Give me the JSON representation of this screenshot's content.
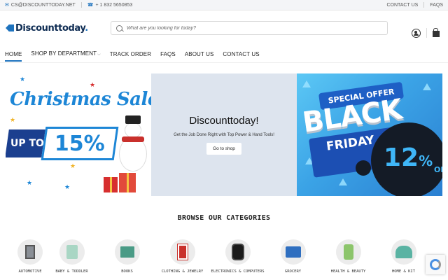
{
  "topbar": {
    "email": "CS@DISCOUNTTODAY.NET",
    "phone": "+ 1 832 5650853",
    "links": [
      "CONTACT US",
      "FAQS"
    ]
  },
  "header": {
    "logo_text": "Discounttoday",
    "logo_dot": ".",
    "search_placeholder": "What are you looking for today?"
  },
  "nav": {
    "items": [
      {
        "label": "HOME",
        "active": true
      },
      {
        "label": "SHOP BY DEPARTMENT",
        "caret": "⌵"
      },
      {
        "label": "TRACK ORDER"
      },
      {
        "label": "FAQS"
      },
      {
        "label": "ABOUT US"
      },
      {
        "label": "CONTACT US"
      }
    ]
  },
  "banners": {
    "christmas": {
      "title": "Christmas Sale",
      "upto": "UP TO",
      "percent": "15%"
    },
    "center": {
      "title": "Discounttoday!",
      "subtitle": "Get the Job Done Right with Top Power & Hand Tools!",
      "button": "Go to shop"
    },
    "blackfriday": {
      "ribbon": "SPECIAL OFFER",
      "black": "BLACK",
      "friday": "FRIDAY",
      "percent": "12",
      "percent_sign": "%",
      "off": "OFF"
    }
  },
  "categories": {
    "title": "BROWSE OUR CATEGORIES",
    "items": [
      {
        "label": "AUTOMOTIVE",
        "icon": "car-jack-icon",
        "color": "#8a8f96"
      },
      {
        "label": "BABY & TODDLER",
        "icon": "baby-product-icon",
        "color": "#a9d6c4"
      },
      {
        "label": "BOOKS",
        "icon": "book-icon",
        "color": "#4a9b86"
      },
      {
        "label": "CLOTHING & JEWELRY",
        "icon": "clothing-icon",
        "color": "#c9302c"
      },
      {
        "label": "ELECTRONICS & COMPUTERS",
        "icon": "smartwatch-icon",
        "color": "#1a1a1a"
      },
      {
        "label": "GROCERY",
        "icon": "grocery-icon",
        "color": "#2f6fc0"
      },
      {
        "label": "HEALTH & BEAUTY",
        "icon": "health-product-icon",
        "color": "#8cc56b"
      },
      {
        "label": "HOME & KIT",
        "icon": "home-kitchen-icon",
        "color": "#5ab3a3"
      }
    ]
  },
  "colors": {
    "accent": "#1e73be",
    "dark_blue": "#0d2b52"
  }
}
